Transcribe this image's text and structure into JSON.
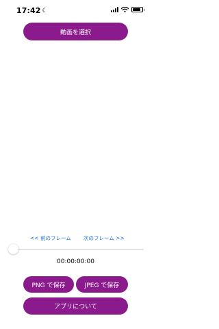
{
  "status_bar": {
    "time": "17:42",
    "moon_glyph": "☾",
    "signal_icon": "cellular-signal-icon",
    "wifi_icon": "wifi-icon",
    "battery_icon": "battery-icon",
    "battery_level": 0.85
  },
  "buttons": {
    "select_video": "動画を選択",
    "save_png": "PNG で保存",
    "save_jpeg": "JPEG で保存",
    "about": "アプリについて"
  },
  "frame_nav": {
    "prev": "<< 前のフレーム",
    "next": "次のフレーム >>"
  },
  "slider": {
    "value": 0
  },
  "timecode": "00:00:00:00",
  "colors": {
    "accent": "#8b1a8c",
    "link": "#1a73e8"
  }
}
